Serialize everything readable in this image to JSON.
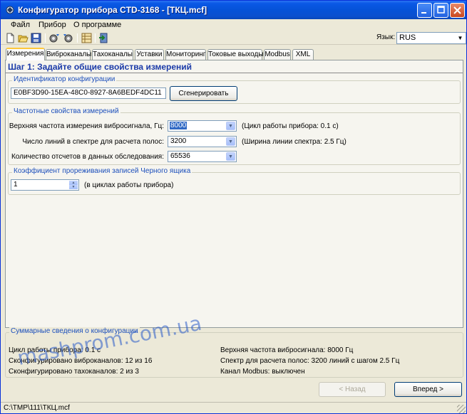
{
  "window": {
    "title": "Конфигуратор прибора CTD-3168 - [ТКЦ.mcf]"
  },
  "menu": {
    "file": "Файл",
    "device": "Прибор",
    "about": "О программе"
  },
  "toolbar": {
    "language_label": "Язык:",
    "language_value": "RUS"
  },
  "tabs": [
    "Измерения",
    "Виброканалы",
    "Тахоканалы",
    "Уставки",
    "Мониторинг",
    "Токовые выходы",
    "Modbus",
    "XML"
  ],
  "step": {
    "title": "Шаг 1: Задайте общие свойства измерений"
  },
  "config_id": {
    "group_title": "Идентификатор конфигурации",
    "value": "E0BF3D90-15EA-48C0-8927-8A6BEDF4DC11",
    "generate_button": "Сгенерировать"
  },
  "freq": {
    "group_title": "Частотные свойства измерений",
    "upper_freq_label": "Верхняя частота измерения вибросигнала, Гц:",
    "upper_freq_value": "8000",
    "upper_freq_note": "(Цикл работы прибора: 0.1 с)",
    "lines_label": "Число линий в спектре для расчета полос:",
    "lines_value": "3200",
    "lines_note": "(Ширина линии спектра: 2.5 Гц)",
    "samples_label": "Количество отсчетов в данных обследования:",
    "samples_value": "65536"
  },
  "blackbox": {
    "group_title": "Коэффициент прореживания записей Черного ящика",
    "value": "1",
    "note": "(в циклах работы прибора)"
  },
  "summary": {
    "group_title": "Суммарные сведения о конфигурации",
    "cycle": "Цикл работы прибора: 0.1 с",
    "vibro": "Сконфигурировано виброканалов: 12 из 16",
    "tacho": "Сконфигурировано тахоканалов: 2 из 3",
    "upper_freq": "Верхняя частота вибросигнала: 8000 Гц",
    "spectrum": "Спектр для расчета полос: 3200 линий с шагом 2.5 Гц",
    "modbus": "Канал Modbus: выключен"
  },
  "nav": {
    "back": "< Назад",
    "next": "Вперед >"
  },
  "status": {
    "path": "C:\\TMP\\111\\ТКЦ.mcf"
  },
  "watermark": "mashprom.com.ua"
}
